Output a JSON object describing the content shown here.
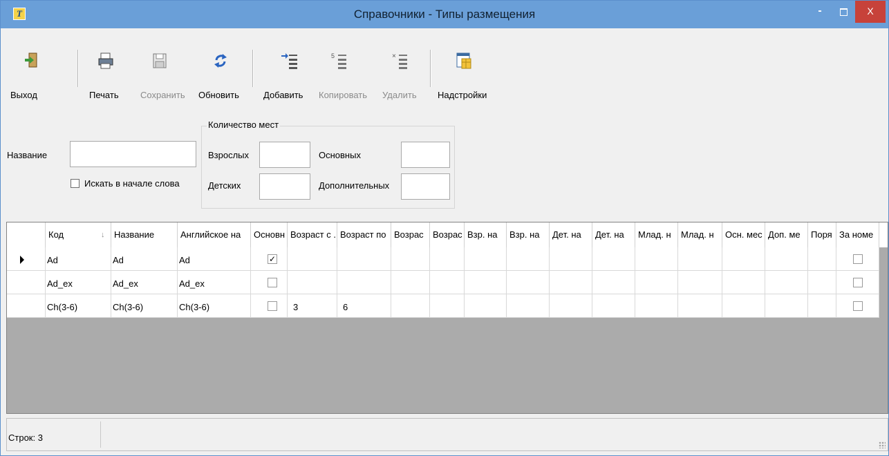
{
  "window": {
    "title": "Справочники - Типы размещения",
    "app_icon_letter": "T",
    "min_glyph": "-",
    "close_glyph": "X"
  },
  "toolbar": {
    "exit": "Выход",
    "print": "Печать",
    "save": "Сохранить",
    "refresh": "Обновить",
    "add": "Добавить",
    "copy": "Копировать",
    "delete": "Удалить",
    "settings": "Надстройки"
  },
  "filters": {
    "name_label": "Название",
    "name_value": "",
    "search_start_label": "Искать в начале слова",
    "search_start_checked": false,
    "group_title": "Количество мест",
    "adults_label": "Взрослых",
    "children_label": "Детских",
    "main_label": "Основных",
    "extra_label": "Дополнительных"
  },
  "grid": {
    "columns": [
      "Код",
      "Название",
      "Английское на",
      "Основн",
      "Возраст с .",
      "Возраст по",
      "Возрас",
      "Возрас",
      "Взр. на",
      "Взр. на",
      "Дет. на",
      "Дет. на",
      "Млад. н",
      "Млад. н",
      "Осн. мес",
      "Доп. ме",
      "Поря",
      "За номе"
    ],
    "sort_glyph": "↓",
    "rows": [
      {
        "code": "Ad",
        "name": "Ad",
        "english": "Ad",
        "main_checked": true,
        "age_from": "",
        "age_to": "",
        "per_room_checked": false
      },
      {
        "code": "Ad_ex",
        "name": "Ad_ex",
        "english": "Ad_ex",
        "main_checked": false,
        "age_from": "",
        "age_to": "",
        "per_room_checked": false
      },
      {
        "code": "Ch(3-6)",
        "name": "Ch(3-6)",
        "english": "Ch(3-6)",
        "main_checked": false,
        "age_from": "3",
        "age_to": "6",
        "per_room_checked": false
      }
    ],
    "selected_row": 0,
    "checkmark": "✓"
  },
  "status": {
    "rows_text": "Строк: 3"
  },
  "colors": {
    "titlebar": "#6a9fd8",
    "close_button": "#c7423a",
    "window_bg": "#f0f0f0",
    "grid_empty_bg": "#ababab"
  }
}
